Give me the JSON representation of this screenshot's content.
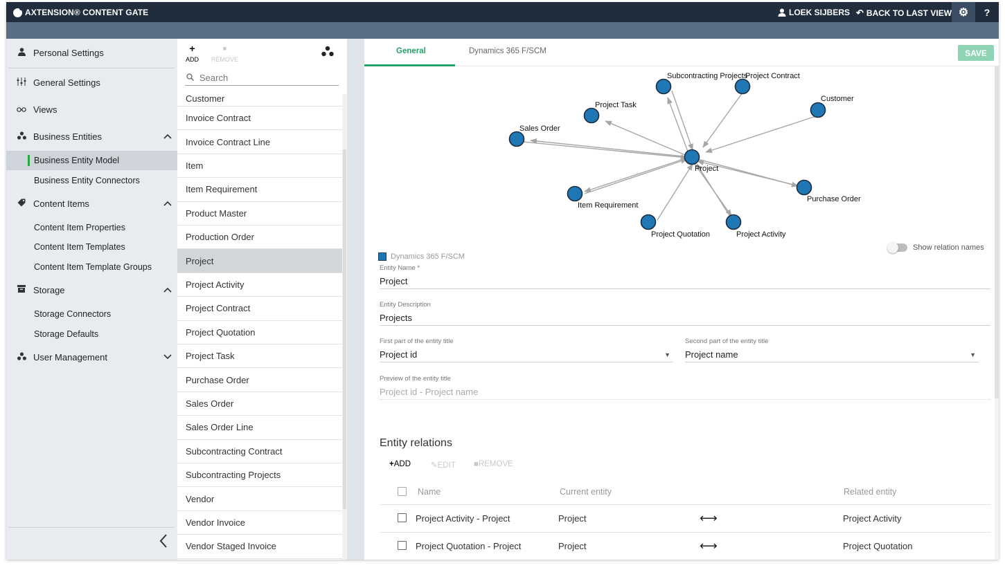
{
  "app": {
    "title": "AXTENSION® CONTENT GATE",
    "user": "LOEK SIJBERS",
    "back_label": "BACK TO LAST VIEW",
    "help_label": "?"
  },
  "sidebar": {
    "personal_settings": "Personal Settings",
    "general_settings": "General Settings",
    "views": "Views",
    "business_entities": "Business Entities",
    "business_entity_model": "Business Entity Model",
    "business_entity_connectors": "Business Entity Connectors",
    "content_items": "Content Items",
    "content_item_properties": "Content Item Properties",
    "content_item_templates": "Content Item Templates",
    "content_item_template_groups": "Content Item Template Groups",
    "storage": "Storage",
    "storage_connectors": "Storage Connectors",
    "storage_defaults": "Storage Defaults",
    "user_management": "User Management"
  },
  "list_panel": {
    "add_label": "ADD",
    "remove_label": "REMOVE",
    "search_placeholder": "Search",
    "items": [
      "Customer",
      "Invoice Contract",
      "Invoice Contract Line",
      "Item",
      "Item Requirement",
      "Product Master",
      "Production Order",
      "Project",
      "Project Activity",
      "Project Contract",
      "Project Quotation",
      "Project Task",
      "Purchase Order",
      "Sales Order",
      "Sales Order Line",
      "Subcontracting Contract",
      "Subcontracting Projects",
      "Vendor",
      "Vendor Invoice",
      "Vendor Staged Invoice"
    ],
    "selected": "Project"
  },
  "main": {
    "tabs": [
      "General",
      "Dynamics 365 F/SCM"
    ],
    "save_label": "SAVE",
    "graph": {
      "center": "Project",
      "nodes": [
        "Subcontracting Projects",
        "Project Contract",
        "Customer",
        "Project Task",
        "Sales Order",
        "Item Requirement",
        "Purchase Order",
        "Project Quotation",
        "Project Activity"
      ],
      "legend_label": "Dynamics 365 F/SCM",
      "node_color": "#1f77b4"
    },
    "show_relation_names": "Show relation names",
    "fields": {
      "entity_name_label": "Entity Name *",
      "entity_name_value": "Project",
      "entity_description_label": "Entity Description",
      "entity_description_value": "Projects",
      "first_part_label": "First part of the entity title",
      "first_part_value": "Project id",
      "second_part_label": "Second part of the entity title",
      "second_part_value": "Project name",
      "preview_label": "Preview of the entity title",
      "preview_value": "Project id - Project name"
    },
    "relations": {
      "title": "Entity relations",
      "add_label": "ADD",
      "edit_label": "EDIT",
      "remove_label": "REMOVE",
      "headers": {
        "name": "Name",
        "current": "Current entity",
        "related": "Related entity"
      },
      "rows": [
        {
          "name": "Project Activity - Project",
          "current": "Project",
          "related": "Project Activity"
        },
        {
          "name": "Project Quotation - Project",
          "current": "Project",
          "related": "Project Quotation"
        }
      ]
    }
  }
}
